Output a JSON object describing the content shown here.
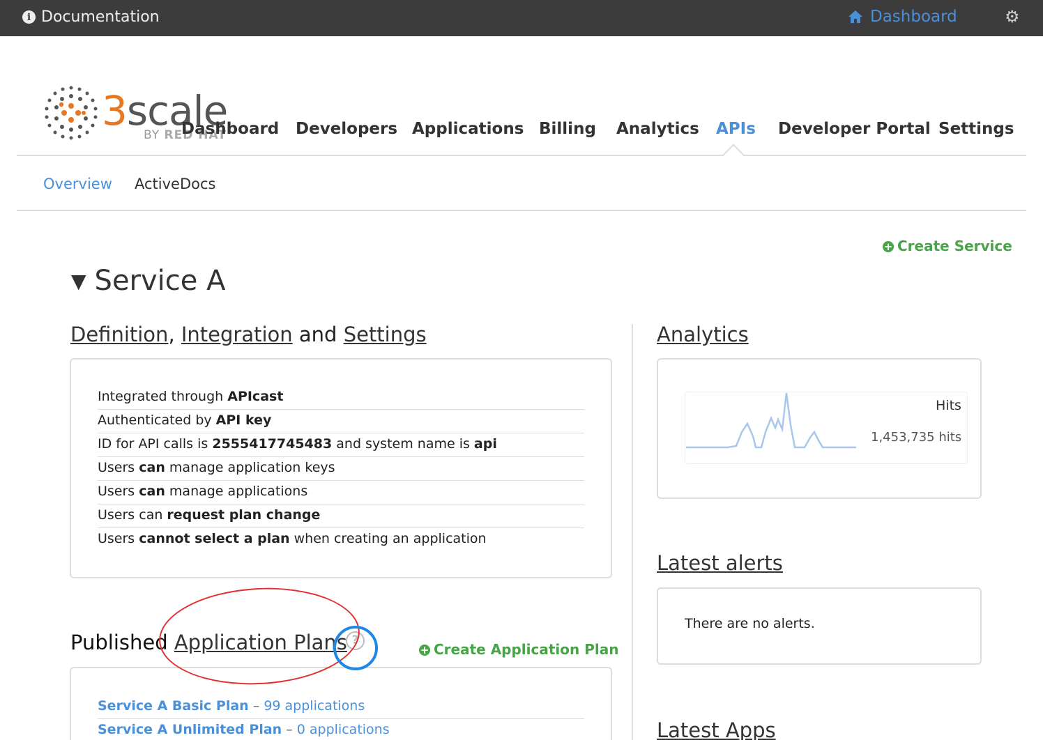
{
  "topbar": {
    "documentation_label": "Documentation",
    "dashboard_label": "Dashboard"
  },
  "logo": {
    "digit": "3",
    "word": "scale",
    "sub_prefix": "BY ",
    "sub_brand": "RED HAT"
  },
  "main_nav": {
    "items": [
      "Dashboard",
      "Developers",
      "Applications",
      "Billing",
      "Analytics",
      "APIs",
      "Developer Portal",
      "Settings"
    ],
    "active": "APIs"
  },
  "sub_nav": {
    "items": [
      "Overview",
      "ActiveDocs"
    ],
    "active": "Overview"
  },
  "create_service_label": "Create Service",
  "service": {
    "title": "Service A"
  },
  "definition_section": {
    "heading_link1": "Definition",
    "heading_sep1": ", ",
    "heading_link2": "Integration",
    "heading_sep2": " and ",
    "heading_link3": "Settings",
    "rows": [
      {
        "a": "Integrated through ",
        "b": "APIcast",
        "c": "",
        "d": "",
        "e": ""
      },
      {
        "a": "Authenticated by ",
        "b": "API key",
        "c": "",
        "d": "",
        "e": ""
      },
      {
        "a": "ID for API calls is ",
        "b": "2555417745483",
        "c": " and system name is ",
        "d": "api",
        "e": ""
      },
      {
        "a": "Users ",
        "b": "can",
        "c": " manage application keys",
        "d": "",
        "e": ""
      },
      {
        "a": "Users ",
        "b": "can",
        "c": " manage applications",
        "d": "",
        "e": ""
      },
      {
        "a": "Users can ",
        "b": "request plan change",
        "c": "",
        "d": "",
        "e": ""
      },
      {
        "a": "Users ",
        "b": "cannot select a plan",
        "c": " when creating an application",
        "d": "",
        "e": ""
      }
    ]
  },
  "analytics_section": {
    "heading": "Analytics",
    "metric_label": "Hits",
    "metric_value": "1,453,735 hits"
  },
  "alerts_section": {
    "heading": "Latest alerts",
    "empty_text": "There are no alerts."
  },
  "latest_apps_heading": "Latest Apps",
  "plans_section": {
    "heading_prefix": "Published ",
    "heading_link": "Application Plans",
    "help_glyph": "?",
    "create_label": "Create Application Plan",
    "plans": [
      {
        "name": "Service A Basic Plan",
        "sep": " – ",
        "count": "99 applications"
      },
      {
        "name": "Service A Unlimited Plan",
        "sep": " – ",
        "count": "0 applications"
      }
    ]
  },
  "colors": {
    "topbar_bg": "#3c3c3c",
    "link_blue": "#4a90d9",
    "action_green": "#47a447",
    "brand_orange": "#e87722",
    "annotation_red": "#e03030",
    "annotation_blue": "#1e88e5"
  },
  "icons": [
    "info-icon",
    "home-icon",
    "gear-icon",
    "plus-circle-icon",
    "triangle-down-icon",
    "question-icon"
  ]
}
